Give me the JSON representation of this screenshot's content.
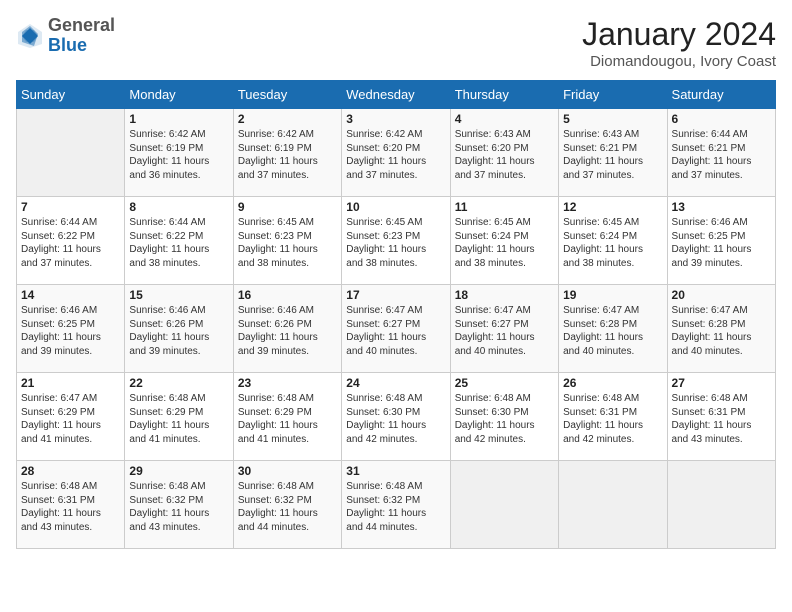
{
  "logo": {
    "general": "General",
    "blue": "Blue"
  },
  "title": "January 2024",
  "subtitle": "Diomandougou, Ivory Coast",
  "days_of_week": [
    "Sunday",
    "Monday",
    "Tuesday",
    "Wednesday",
    "Thursday",
    "Friday",
    "Saturday"
  ],
  "weeks": [
    [
      {
        "day": "",
        "info": ""
      },
      {
        "day": "1",
        "info": "Sunrise: 6:42 AM\nSunset: 6:19 PM\nDaylight: 11 hours\nand 36 minutes."
      },
      {
        "day": "2",
        "info": "Sunrise: 6:42 AM\nSunset: 6:19 PM\nDaylight: 11 hours\nand 37 minutes."
      },
      {
        "day": "3",
        "info": "Sunrise: 6:42 AM\nSunset: 6:20 PM\nDaylight: 11 hours\nand 37 minutes."
      },
      {
        "day": "4",
        "info": "Sunrise: 6:43 AM\nSunset: 6:20 PM\nDaylight: 11 hours\nand 37 minutes."
      },
      {
        "day": "5",
        "info": "Sunrise: 6:43 AM\nSunset: 6:21 PM\nDaylight: 11 hours\nand 37 minutes."
      },
      {
        "day": "6",
        "info": "Sunrise: 6:44 AM\nSunset: 6:21 PM\nDaylight: 11 hours\nand 37 minutes."
      }
    ],
    [
      {
        "day": "7",
        "info": "Sunrise: 6:44 AM\nSunset: 6:22 PM\nDaylight: 11 hours\nand 37 minutes."
      },
      {
        "day": "8",
        "info": "Sunrise: 6:44 AM\nSunset: 6:22 PM\nDaylight: 11 hours\nand 38 minutes."
      },
      {
        "day": "9",
        "info": "Sunrise: 6:45 AM\nSunset: 6:23 PM\nDaylight: 11 hours\nand 38 minutes."
      },
      {
        "day": "10",
        "info": "Sunrise: 6:45 AM\nSunset: 6:23 PM\nDaylight: 11 hours\nand 38 minutes."
      },
      {
        "day": "11",
        "info": "Sunrise: 6:45 AM\nSunset: 6:24 PM\nDaylight: 11 hours\nand 38 minutes."
      },
      {
        "day": "12",
        "info": "Sunrise: 6:45 AM\nSunset: 6:24 PM\nDaylight: 11 hours\nand 38 minutes."
      },
      {
        "day": "13",
        "info": "Sunrise: 6:46 AM\nSunset: 6:25 PM\nDaylight: 11 hours\nand 39 minutes."
      }
    ],
    [
      {
        "day": "14",
        "info": "Sunrise: 6:46 AM\nSunset: 6:25 PM\nDaylight: 11 hours\nand 39 minutes."
      },
      {
        "day": "15",
        "info": "Sunrise: 6:46 AM\nSunset: 6:26 PM\nDaylight: 11 hours\nand 39 minutes."
      },
      {
        "day": "16",
        "info": "Sunrise: 6:46 AM\nSunset: 6:26 PM\nDaylight: 11 hours\nand 39 minutes."
      },
      {
        "day": "17",
        "info": "Sunrise: 6:47 AM\nSunset: 6:27 PM\nDaylight: 11 hours\nand 40 minutes."
      },
      {
        "day": "18",
        "info": "Sunrise: 6:47 AM\nSunset: 6:27 PM\nDaylight: 11 hours\nand 40 minutes."
      },
      {
        "day": "19",
        "info": "Sunrise: 6:47 AM\nSunset: 6:28 PM\nDaylight: 11 hours\nand 40 minutes."
      },
      {
        "day": "20",
        "info": "Sunrise: 6:47 AM\nSunset: 6:28 PM\nDaylight: 11 hours\nand 40 minutes."
      }
    ],
    [
      {
        "day": "21",
        "info": "Sunrise: 6:47 AM\nSunset: 6:29 PM\nDaylight: 11 hours\nand 41 minutes."
      },
      {
        "day": "22",
        "info": "Sunrise: 6:48 AM\nSunset: 6:29 PM\nDaylight: 11 hours\nand 41 minutes."
      },
      {
        "day": "23",
        "info": "Sunrise: 6:48 AM\nSunset: 6:29 PM\nDaylight: 11 hours\nand 41 minutes."
      },
      {
        "day": "24",
        "info": "Sunrise: 6:48 AM\nSunset: 6:30 PM\nDaylight: 11 hours\nand 42 minutes."
      },
      {
        "day": "25",
        "info": "Sunrise: 6:48 AM\nSunset: 6:30 PM\nDaylight: 11 hours\nand 42 minutes."
      },
      {
        "day": "26",
        "info": "Sunrise: 6:48 AM\nSunset: 6:31 PM\nDaylight: 11 hours\nand 42 minutes."
      },
      {
        "day": "27",
        "info": "Sunrise: 6:48 AM\nSunset: 6:31 PM\nDaylight: 11 hours\nand 43 minutes."
      }
    ],
    [
      {
        "day": "28",
        "info": "Sunrise: 6:48 AM\nSunset: 6:31 PM\nDaylight: 11 hours\nand 43 minutes."
      },
      {
        "day": "29",
        "info": "Sunrise: 6:48 AM\nSunset: 6:32 PM\nDaylight: 11 hours\nand 43 minutes."
      },
      {
        "day": "30",
        "info": "Sunrise: 6:48 AM\nSunset: 6:32 PM\nDaylight: 11 hours\nand 44 minutes."
      },
      {
        "day": "31",
        "info": "Sunrise: 6:48 AM\nSunset: 6:32 PM\nDaylight: 11 hours\nand 44 minutes."
      },
      {
        "day": "",
        "info": ""
      },
      {
        "day": "",
        "info": ""
      },
      {
        "day": "",
        "info": ""
      }
    ]
  ]
}
